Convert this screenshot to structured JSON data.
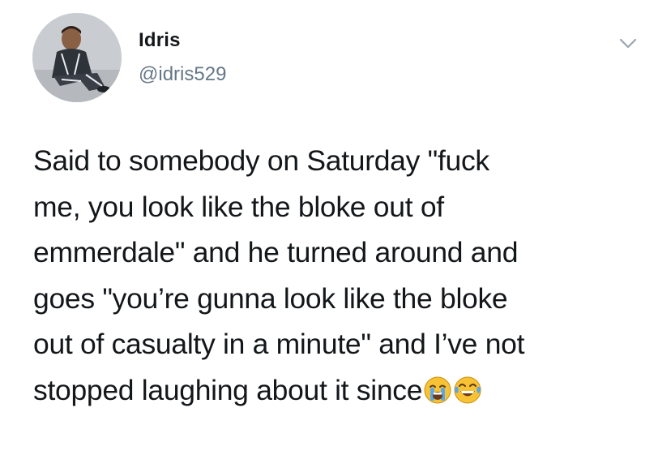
{
  "author": {
    "name": "Idris",
    "handle": "@idris529",
    "avatar_icon": "profile-photo-icon"
  },
  "menu": {
    "icon": "chevron-down-icon"
  },
  "tweet": {
    "lines": [
      "Said to somebody on Saturday \"fuck",
      "me, you look like the bloke out of",
      "emmerdale\" and he turned around and",
      "goes \"you’re gunna look like the bloke",
      "out of casualty in a minute\" and I’ve not",
      "stopped laughing about it since"
    ],
    "emojis": [
      "loudly-crying-face-icon",
      "face-with-tears-of-joy-icon"
    ]
  },
  "colors": {
    "text": "#14171a",
    "secondary": "#657786",
    "emoji_yellow": "#f7c234",
    "emoji_tear": "#5aa7e8"
  }
}
